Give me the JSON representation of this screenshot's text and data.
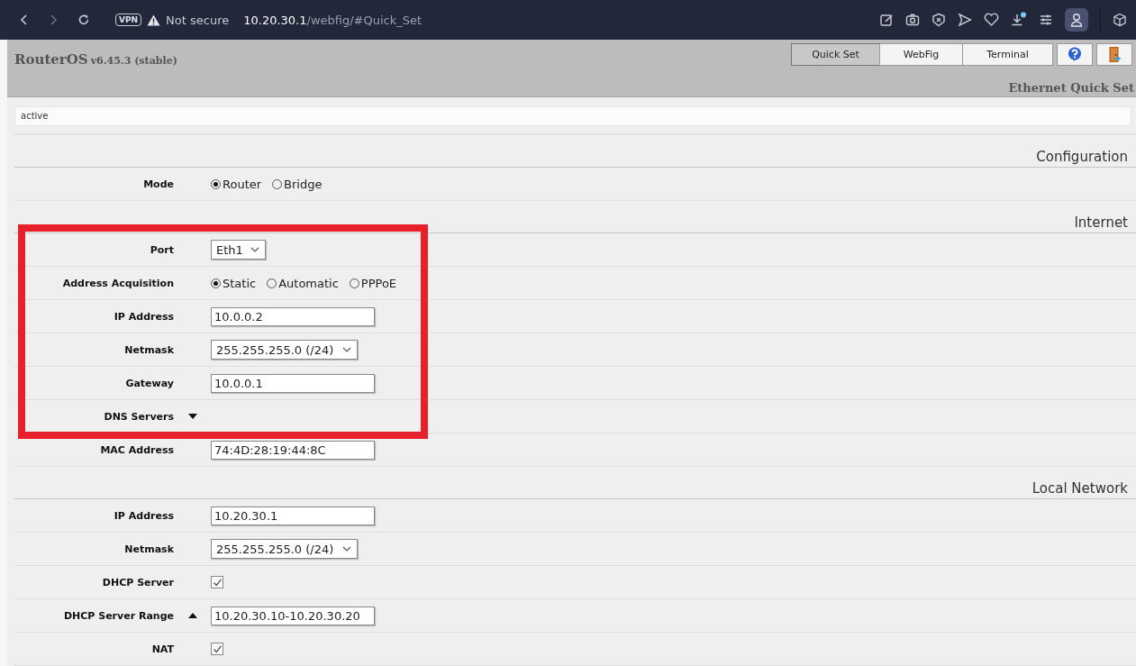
{
  "browser": {
    "vpn": "VPN",
    "security": "Not secure",
    "url": "**10.20.30.1**/webfig/#Quick_Set"
  },
  "header": {
    "product": "RouterOS",
    "version": "v6.45.3 (stable)",
    "tabs": [
      {
        "label": "Quick Set",
        "selected": true
      },
      {
        "label": "WebFig",
        "selected": false
      },
      {
        "label": "Terminal",
        "selected": false
      }
    ],
    "page_title": "Ethernet Quick Set"
  },
  "status": "active",
  "sections": [
    {
      "title": "Configuration",
      "rows": [
        {
          "label": "Mode",
          "kind": "radio",
          "options": [
            {
              "label": "Router",
              "selected": true
            },
            {
              "label": "Bridge",
              "selected": false
            }
          ]
        }
      ]
    },
    {
      "title": "Internet",
      "rows": [
        {
          "kind": "annotation_frame",
          "rows": [
            {
              "label": "Port",
              "kind": "select",
              "value": "Eth1"
            },
            {
              "label": "Address Acquisition",
              "kind": "radio",
              "options": [
                {
                  "label": "Static",
                  "selected": true
                },
                {
                  "label": "Automatic",
                  "selected": false
                },
                {
                  "label": "PPPoE",
                  "selected": false
                }
              ]
            },
            {
              "label": "IP Address",
              "kind": "text",
              "value": "10.0.0.2"
            },
            {
              "label": "Netmask",
              "kind": "select",
              "value": "255.255.255.0 (/24)"
            },
            {
              "label": "Gateway",
              "kind": "text",
              "value": "10.0.0.1"
            },
            {
              "label": "DNS Servers",
              "kind": "toggle",
              "expanded": false
            }
          ]
        },
        {
          "label": "MAC Address",
          "kind": "text",
          "value": "74:4D:28:19:44:8C"
        }
      ]
    },
    {
      "title": "Local Network",
      "rows": [
        {
          "label": "IP Address",
          "kind": "text",
          "value": "10.20.30.1"
        },
        {
          "label": "Netmask",
          "kind": "select",
          "value": "255.255.255.0 (/24)"
        },
        {
          "label": "DHCP Server",
          "kind": "checkbox",
          "checked": true
        },
        {
          "label": "DHCP Server Range",
          "kind": "toggle",
          "expanded": true,
          "value": "10.20.30.10-10.20.30.20"
        },
        {
          "label": "NAT",
          "kind": "checkbox",
          "checked": true
        }
      ]
    }
  ]
}
